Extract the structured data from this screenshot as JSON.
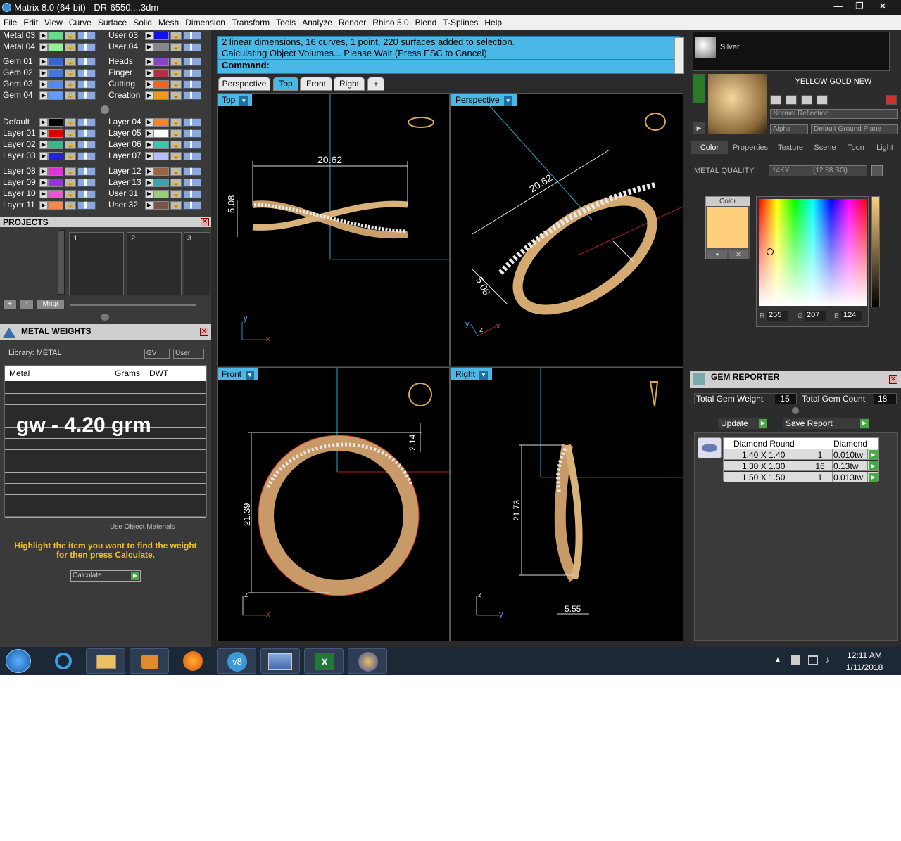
{
  "window": {
    "title": "Matrix 8.0 (64-bit) - DR-6550....3dm",
    "min": "—",
    "max": "❐",
    "close": "✕"
  },
  "menu": [
    "File",
    "Edit",
    "View",
    "Curve",
    "Surface",
    "Solid",
    "Mesh",
    "Dimension",
    "Transform",
    "Tools",
    "Analyze",
    "Render",
    "Rhino 5.0",
    "Blend",
    "T-Splines",
    "Help"
  ],
  "layers": {
    "left": [
      {
        "name": "Metal 03",
        "color": "#66dd88"
      },
      {
        "name": "Metal 04",
        "color": "#99ee99"
      },
      {
        "name": "Gem 01",
        "color": "#3366cc"
      },
      {
        "name": "Gem 02",
        "color": "#4477dd"
      },
      {
        "name": "Gem 03",
        "color": "#5588ee"
      },
      {
        "name": "Gem 04",
        "color": "#6699ff"
      },
      {
        "name": "Default",
        "color": "#000000"
      },
      {
        "name": "Layer 01",
        "color": "#dd0000"
      },
      {
        "name": "Layer 02",
        "color": "#33bb88"
      },
      {
        "name": "Layer 03",
        "color": "#2222dd"
      },
      {
        "name": "Layer 08",
        "color": "#dd33dd"
      },
      {
        "name": "Layer 09",
        "color": "#9933dd"
      },
      {
        "name": "Layer 10",
        "color": "#ee55cc"
      },
      {
        "name": "Layer 11",
        "color": "#ee8855"
      }
    ],
    "right": [
      {
        "name": "User 03",
        "color": "#1111ee"
      },
      {
        "name": "User 04",
        "color": "#888888"
      },
      {
        "name": "Heads",
        "color": "#8844cc"
      },
      {
        "name": "Finger",
        "color": "#aa3344"
      },
      {
        "name": "Cutting",
        "color": "#ee6622"
      },
      {
        "name": "Creation",
        "color": "#ee9922"
      },
      {
        "name": "Layer 04",
        "color": "#ee8833"
      },
      {
        "name": "Layer 05",
        "color": "#ffffff"
      },
      {
        "name": "Layer 06",
        "color": "#33ccaa"
      },
      {
        "name": "Layer 07",
        "color": "#bbbbff"
      },
      {
        "name": "Layer 12",
        "color": "#996644"
      },
      {
        "name": "Layer 13",
        "color": "#33aaaa"
      },
      {
        "name": "User 31",
        "color": "#99cc77"
      },
      {
        "name": "User 32",
        "color": "#775544"
      }
    ]
  },
  "projects": {
    "title": "PROJECTS",
    "slots": [
      "1",
      "2",
      "3"
    ],
    "mngr": "Mngr"
  },
  "metal_weights": {
    "title": "METAL WEIGHTS",
    "library": "Library: METAL",
    "gv": "GV",
    "user": "User",
    "columns": [
      "Metal",
      "Grams",
      "DWT"
    ],
    "overlay": "gw - 4.20 grm",
    "use_object_materials": "Use Object Materials",
    "hint": "Highlight the item you want to find the weight for then press Calculate.",
    "calculate": "Calculate"
  },
  "command": {
    "line1": "2 linear dimensions, 16 curves, 1 point, 220 surfaces added to selection.",
    "line2": "Calculating Object Volumes... Please Wait (Press ESC to Cancel)",
    "prompt": "Command:"
  },
  "view_tabs": [
    "Perspective",
    "Top",
    "Front",
    "Right",
    "+"
  ],
  "viewports": {
    "top": {
      "label": "Top",
      "dim_width": "20.62",
      "dim_height": "5.08"
    },
    "perspective": {
      "label": "Perspective",
      "dim_width": "20.62",
      "dim_height": "5.08"
    },
    "front": {
      "label": "Front",
      "dim_height": "21.39",
      "dim_top": "2.14"
    },
    "right": {
      "label": "Right",
      "dim_height": "21.73",
      "dim_width": "5.55"
    },
    "axis": {
      "x": "x",
      "y": "y",
      "z": "z"
    }
  },
  "materials": {
    "silver": "Silver",
    "name": "YELLOW GOLD NEW",
    "reflection": "Normal Reflection",
    "alpha": "Alpha",
    "ground": "Default Ground Plane"
  },
  "right_tabs": [
    "Color",
    "Properties",
    "Texture",
    "Scene",
    "Toon",
    "Light"
  ],
  "metal_quality": {
    "label": "METAL QUALITY:",
    "value": "14KY",
    "sg": "(12.88 SG)"
  },
  "color": {
    "label": "Color",
    "r_label": "R",
    "r": "255",
    "g_label": "G",
    "g": "207",
    "b_label": "B",
    "b": "124",
    "swatch": "#ffcf7c"
  },
  "gem_reporter": {
    "title": "GEM REPORTER",
    "total_weight_label": "Total Gem Weight",
    "total_weight": ".15",
    "total_count_label": "Total Gem Count",
    "total_count": "18",
    "update": "Update",
    "save_report": "Save Report",
    "headers": [
      "Diamond Round",
      "Diamond"
    ],
    "rows": [
      {
        "size": "1.40 X 1.40",
        "count": "1",
        "weight": "0.010tw"
      },
      {
        "size": "1.30 X 1.30",
        "count": "16",
        "weight": "0.13tw"
      },
      {
        "size": "1.50 X 1.50",
        "count": "1",
        "weight": "0.013tw"
      }
    ]
  },
  "taskbar": {
    "time": "12:11 AM",
    "date": "1/11/2018"
  }
}
